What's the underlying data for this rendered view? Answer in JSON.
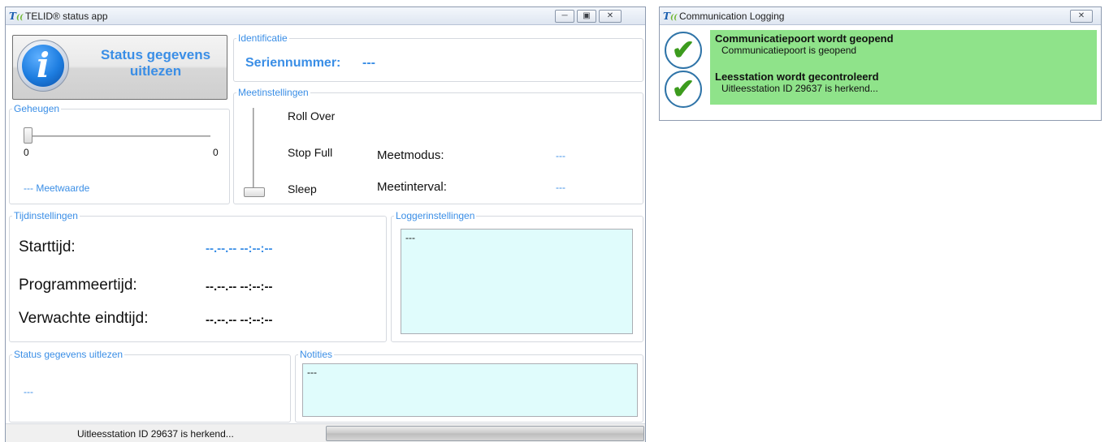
{
  "main_window": {
    "title": "TELID® status app",
    "logo_text": "T",
    "logo_sub": "(("
  },
  "status_button": {
    "label": "Status gegevens uitlezen",
    "icon_glyph": "i"
  },
  "identificatie": {
    "title": "Identificatie",
    "serial_label": "Seriennummer:",
    "serial_value": "---"
  },
  "geheugen": {
    "title": "Geheugen",
    "slider_min": "0",
    "slider_max": "0",
    "slider_fraction": 0,
    "meetwaarde": "--- Meetwaarde"
  },
  "meetinstellingen": {
    "title": "Meetinstellingen",
    "modes": [
      "Roll Over",
      "Stop Full",
      "Sleep"
    ],
    "selected_mode_index": 2,
    "meetmodus_label": "Meetmodus:",
    "meetmodus_value": "---",
    "meetinterval_label": "Meetinterval:",
    "meetinterval_value": "---"
  },
  "tijdinstellingen": {
    "title": "Tijdinstellingen",
    "start_label": "Starttijd:",
    "start_value": "--.--.-- --:--:--",
    "prog_label": "Programmeertijd:",
    "prog_value": "--.--.-- --:--:--",
    "end_label": "Verwachte eindtijd:",
    "end_value": "--.--.-- --:--:--"
  },
  "loggerinstellingen": {
    "title": "Loggerinstellingen",
    "text": "---"
  },
  "status_section": {
    "title": "Status gegevens uitlezen",
    "value": "---"
  },
  "notities": {
    "title": "Notities",
    "text": "---"
  },
  "statusbar": {
    "text": "Uitleesstation ID 29637 is herkend..."
  },
  "log_window": {
    "title": "Communication Logging",
    "entries": [
      {
        "title": "Communicatiepoort wordt geopend",
        "detail": "Communicatiepoort is geopend"
      },
      {
        "title": "Leesstation wordt gecontroleerd",
        "detail": "Uitleesstation ID 29637 is herkend..."
      }
    ]
  },
  "colors": {
    "accent_blue": "#3a8ee6",
    "textbox_fill": "#e0fcfc",
    "log_success": "#8fe38a",
    "check_green": "#3c9b1d"
  }
}
